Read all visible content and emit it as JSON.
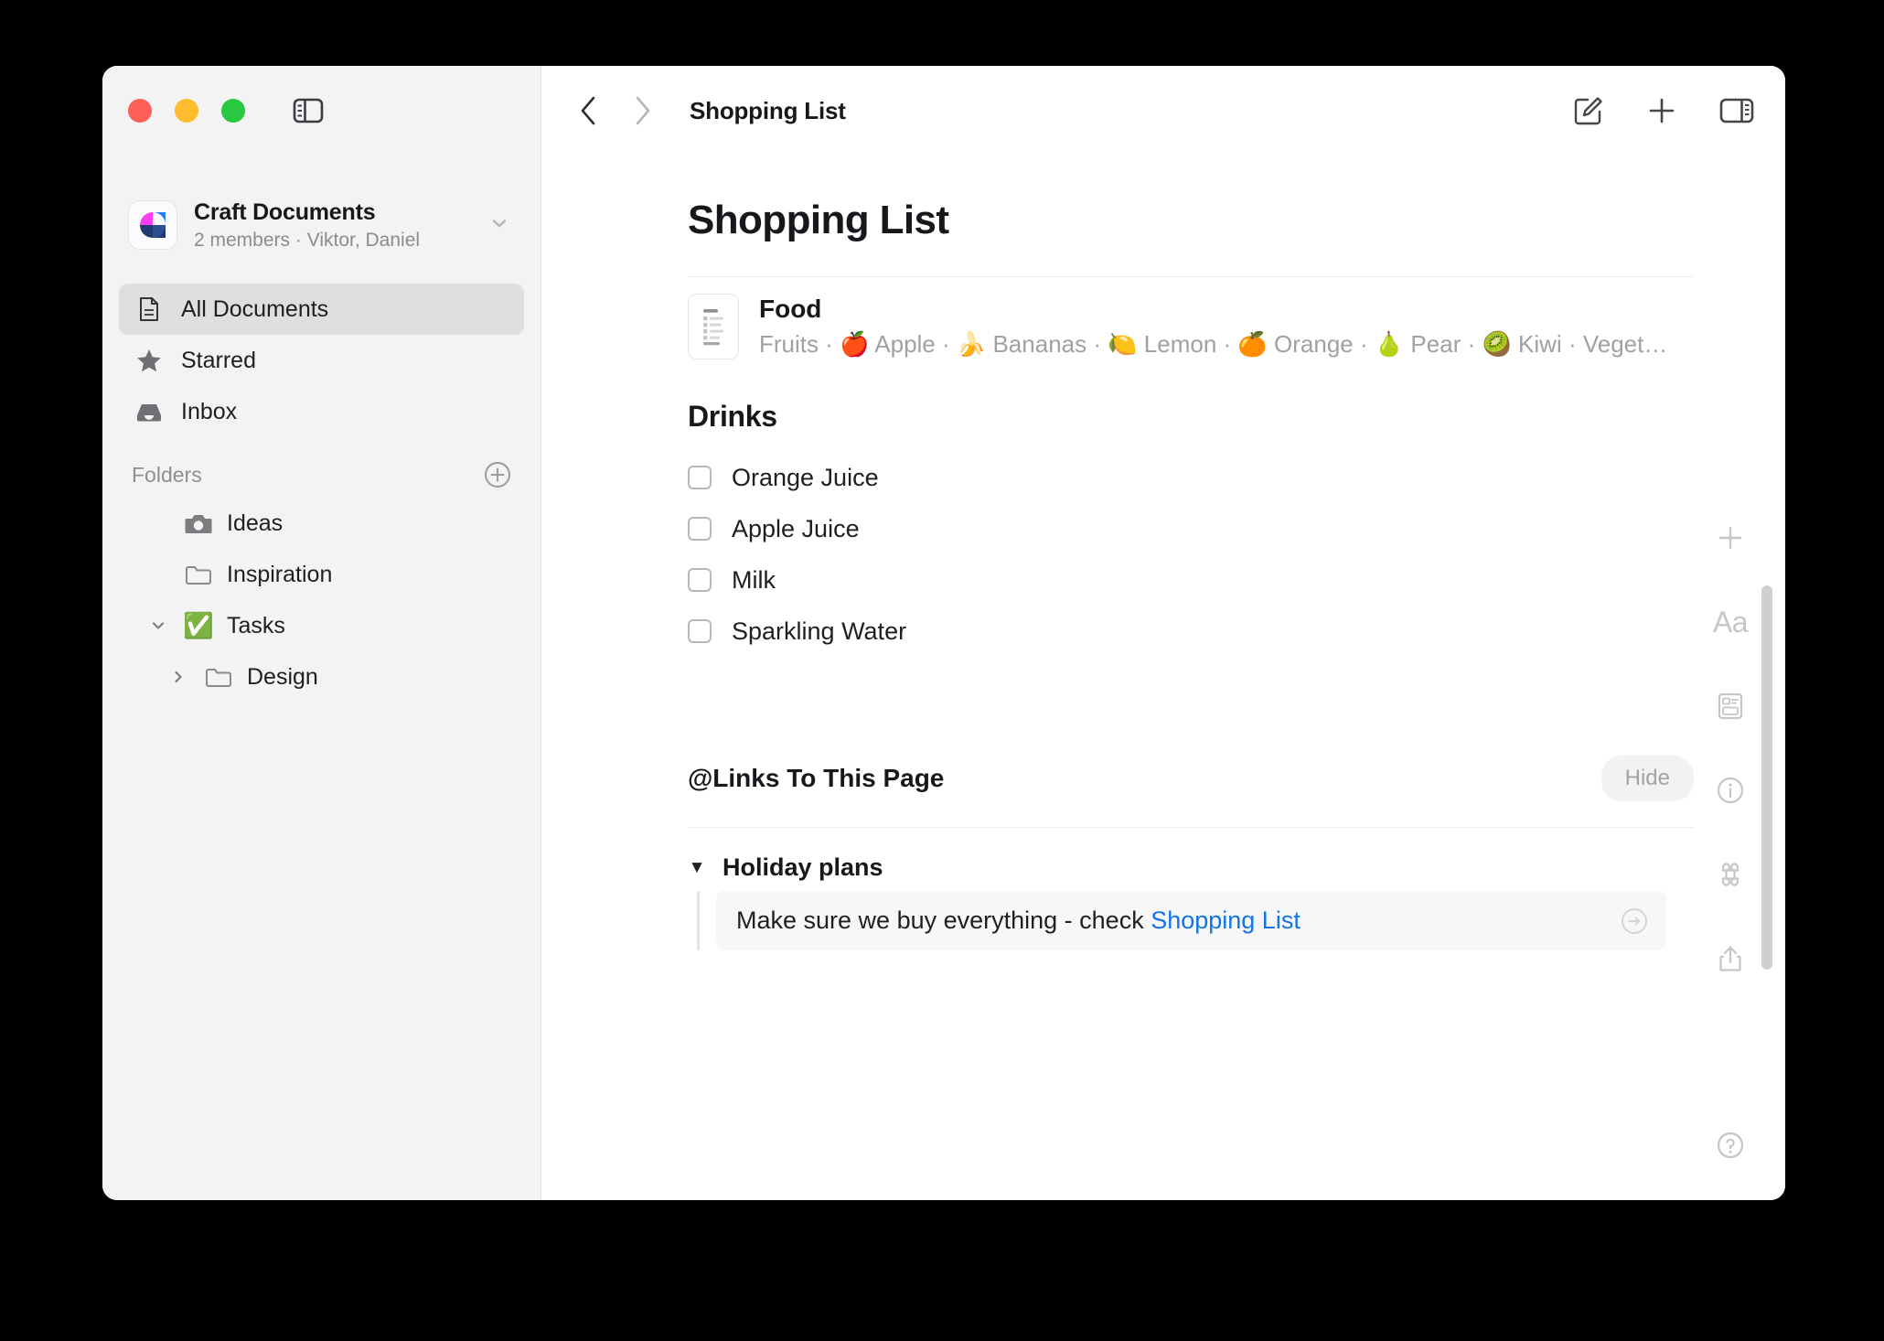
{
  "window": {
    "traffic_lights": [
      "close",
      "minimize",
      "zoom"
    ],
    "sidebar_toggle_icon": "sidebar-left-toggle-icon"
  },
  "sidebar": {
    "workspace": {
      "name": "Craft Documents",
      "subtitle": "2 members · Viktor, Daniel",
      "logo_icon": "craft-logo-icon",
      "chevron_icon": "chevron-down-icon"
    },
    "nav": [
      {
        "label": "All Documents",
        "icon": "document-icon",
        "selected": true
      },
      {
        "label": "Starred",
        "icon": "star-icon",
        "selected": false
      },
      {
        "label": "Inbox",
        "icon": "inbox-icon",
        "selected": false
      }
    ],
    "folders_section": {
      "title": "Folders",
      "add_icon": "plus-circle-icon",
      "items": [
        {
          "label": "Ideas",
          "icon": "camera-icon",
          "emoji": "",
          "nested": false,
          "chevron": ""
        },
        {
          "label": "Inspiration",
          "icon": "folder-icon",
          "emoji": "",
          "nested": false,
          "chevron": ""
        },
        {
          "label": "Tasks",
          "icon": "emoji-icon",
          "emoji": "✅",
          "nested": false,
          "chevron": "expanded"
        },
        {
          "label": "Design",
          "icon": "folder-icon",
          "emoji": "",
          "nested": true,
          "chevron": "collapsed"
        }
      ]
    }
  },
  "toolbar": {
    "back_icon": "chevron-left-icon",
    "forward_icon": "chevron-right-icon",
    "title": "Shopping List",
    "compose_icon": "compose-icon",
    "add_icon": "plus-icon",
    "right_sidebar_icon": "sidebar-right-toggle-icon"
  },
  "document": {
    "title": "Shopping List",
    "card_link": {
      "title": "Food",
      "preview": "Fruits · 🍎 Apple · 🍌 Bananas · 🍋 Lemon · 🍊 Orange · 🍐 Pear · 🥝 Kiwi · Veget…",
      "thumbnail_icon": "document-preview-icon"
    },
    "section_heading": "Drinks",
    "todos": [
      {
        "label": "Orange Juice",
        "checked": false
      },
      {
        "label": "Apple Juice",
        "checked": false
      },
      {
        "label": "Milk",
        "checked": false
      },
      {
        "label": "Sparkling Water",
        "checked": false
      }
    ]
  },
  "backlinks": {
    "title": "@Links To This Page",
    "hide_label": "Hide",
    "group": {
      "caret_icon": "caret-down-icon",
      "title": "Holiday plans",
      "row_text_before": "Make sure we buy everything - check ",
      "row_link": "Shopping List",
      "go_icon": "arrow-right-circle-icon"
    }
  },
  "right_rail": {
    "items": [
      {
        "icon": "plus-icon",
        "label": ""
      },
      {
        "icon": "typography-icon",
        "label": "Aa"
      },
      {
        "icon": "card-style-icon",
        "label": ""
      },
      {
        "icon": "info-circle-icon",
        "label": ""
      },
      {
        "icon": "command-icon",
        "label": ""
      },
      {
        "icon": "share-icon",
        "label": ""
      }
    ],
    "help_icon": "question-circle-icon"
  },
  "colors": {
    "accent_link": "#1473e6",
    "sidebar_bg": "#f4f3f4",
    "selected_row": "#e0dfe0",
    "traffic_red": "#ff5f57",
    "traffic_yellow": "#febc2e",
    "traffic_green": "#28c840"
  }
}
